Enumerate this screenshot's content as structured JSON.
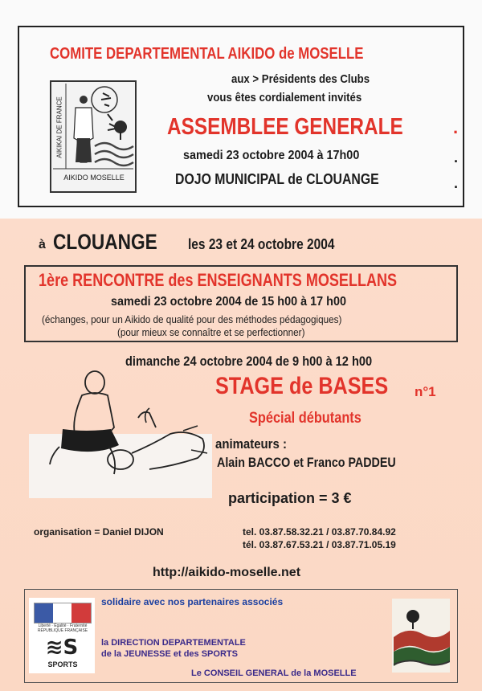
{
  "header": {
    "committee": "COMITE DEPARTEMENTAL  AIKIDO de MOSELLE",
    "to_presidents": "aux > Présidents des Clubs",
    "invited": "vous êtes cordialement invités",
    "assembly": "ASSEMBLEE GENERALE",
    "date_time": "samedi  23 octobre 2004    à 17h00",
    "venue": "DOJO MUNICIPAL  de CLOUANGE",
    "logo_left_text": "AIKIKAI DE FRANCE",
    "logo_bottom_text": "AIKIDO MOSELLE",
    "dot": "."
  },
  "event": {
    "city_prefix": "à",
    "city": "CLOUANGE",
    "dates": "les 23 et 24 octobre 2004",
    "meeting_title": "1ère  RENCONTRE des ENSEIGNANTS MOSELLANS",
    "meeting_when": "samedi  23 octobre 2004  de  15 h00 à  17 h00",
    "meeting_desc1": "(échanges, pour un Aikido de qualité pour des méthodes pédagogiques)",
    "meeting_desc2": "(pour mieux se connaître et se perfectionner)",
    "sunday": "dimanche  24 octobre 2004    de  9 h00 à 12 h00",
    "stage": "STAGE de BASES",
    "stage_num": "n°1",
    "beginners": "Spécial  débutants",
    "animators_label": "animateurs :",
    "animators": "Alain  BACCO  et  Franco  PADDEU",
    "participation": "participation   =   3 €"
  },
  "contact": {
    "organisation": "organisation  =  Daniel DIJON",
    "tel1": "tel.   03.87.58.32.21 / 03.87.70.84.92",
    "tel2": "tél.   03.87.67.53.21 / 03.87.71.05.19",
    "website": "http://aikido-moselle.net"
  },
  "partners": {
    "intro": "solidaire avec  nos partenaires associés",
    "dir1": "la DIRECTION DEPARTEMENTALE",
    "dir2": "de la JEUNESSE et des SPORTS",
    "council": "Le CONSEIL GENERAL de la MOSELLE",
    "republique": "Liberté · Égalité · Fraternité",
    "republique2": "RÉPUBLIQUE FRANÇAISE",
    "sports_logo": "SPORTS"
  },
  "colors": {
    "accent_red": "#e2342b",
    "paper_top": "#fafafa",
    "paper_bottom": "#fbd9c6"
  }
}
